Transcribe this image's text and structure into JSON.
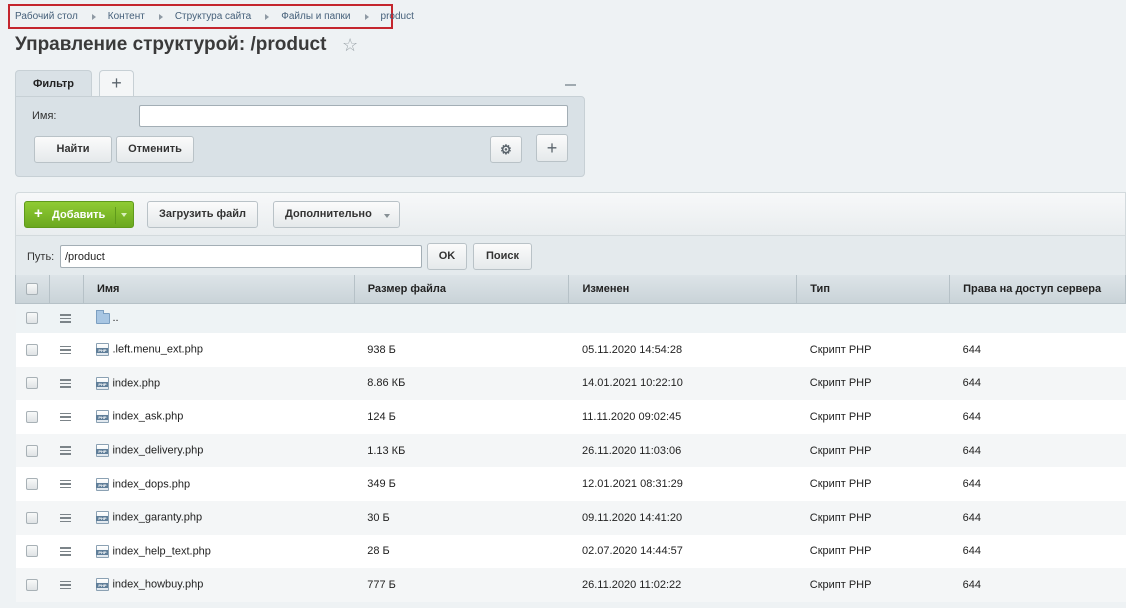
{
  "breadcrumbs": [
    "Рабочий стол",
    "Контент",
    "Структура сайта",
    "Файлы и папки",
    "product"
  ],
  "page_title": "Управление структурой: /product",
  "filter": {
    "tab_label": "Фильтр",
    "add_tab": "+",
    "name_label": "Имя:",
    "name_value": "",
    "find_button": "Найти",
    "cancel_button": "Отменить",
    "plus_button": "+"
  },
  "toolbar": {
    "add_button": "Добавить",
    "upload_button": "Загрузить файл",
    "more_button": "Дополнительно"
  },
  "path": {
    "label": "Путь:",
    "value": "/product",
    "ok_button": "OK",
    "search_button": "Поиск"
  },
  "table": {
    "columns": [
      "Имя",
      "Размер файла",
      "Изменен",
      "Тип",
      "Права на доступ сервера"
    ],
    "parent_label": "..",
    "rows": [
      {
        "name": ".left.menu_ext.php",
        "size": "938 Б",
        "modified": "05.11.2020 14:54:28",
        "type": "Скрипт PHP",
        "perms": "644"
      },
      {
        "name": "index.php",
        "size": "8.86 КБ",
        "modified": "14.01.2021 10:22:10",
        "type": "Скрипт PHP",
        "perms": "644"
      },
      {
        "name": "index_ask.php",
        "size": "124 Б",
        "modified": "11.11.2020 09:02:45",
        "type": "Скрипт PHP",
        "perms": "644"
      },
      {
        "name": "index_delivery.php",
        "size": "1.13 КБ",
        "modified": "26.11.2020 11:03:06",
        "type": "Скрипт PHP",
        "perms": "644"
      },
      {
        "name": "index_dops.php",
        "size": "349 Б",
        "modified": "12.01.2021 08:31:29",
        "type": "Скрипт PHP",
        "perms": "644"
      },
      {
        "name": "index_garanty.php",
        "size": "30 Б",
        "modified": "09.11.2020 14:41:20",
        "type": "Скрипт PHP",
        "perms": "644"
      },
      {
        "name": "index_help_text.php",
        "size": "28 Б",
        "modified": "02.07.2020 14:44:57",
        "type": "Скрипт PHP",
        "perms": "644"
      },
      {
        "name": "index_howbuy.php",
        "size": "777 Б",
        "modified": "26.11.2020 11:02:22",
        "type": "Скрипт PHP",
        "perms": "644"
      }
    ]
  }
}
